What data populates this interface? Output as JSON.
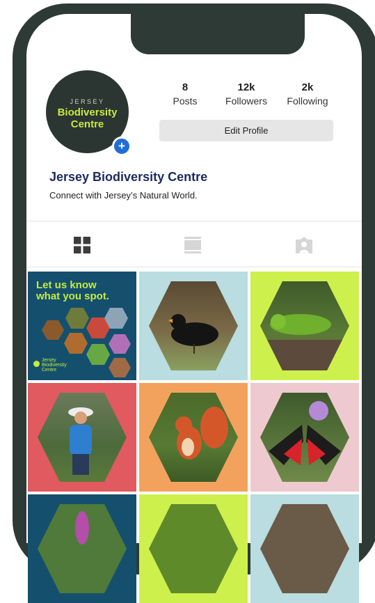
{
  "profile": {
    "avatar_line1": "JERSEY",
    "avatar_line2": "Biodiversity",
    "avatar_line3": "Centre",
    "add_icon": "+",
    "name": "Jersey Biodiversity Centre",
    "bio": "Connect with Jersey’s Natural World."
  },
  "stats": [
    {
      "value": "8",
      "label": "Posts"
    },
    {
      "value": "12k",
      "label": "Followers"
    },
    {
      "value": "2k",
      "label": "Following"
    }
  ],
  "edit_profile_label": "Edit Profile",
  "tabs": {
    "grid_icon": "grid-icon",
    "feed_icon": "feed-icon",
    "tagged_icon": "tagged-icon"
  },
  "posts": {
    "post1_heading_line1": "Let us know",
    "post1_heading_line2": "what you spot.",
    "post1_logo_line1": "Jersey",
    "post1_logo_line2": "Biodiversity",
    "post1_logo_line3": "Centre"
  },
  "colors": {
    "frame": "#2d3a36",
    "name_blue": "#1c2a5e",
    "accent_lime": "#c7ea3f",
    "plus_blue": "#1f6fd6"
  }
}
